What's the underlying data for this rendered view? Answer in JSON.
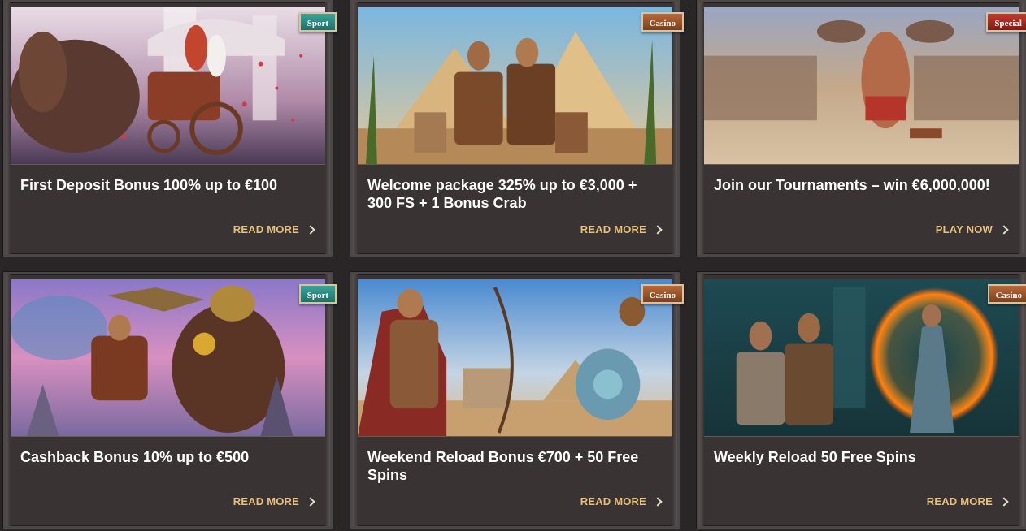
{
  "promotions": [
    {
      "badge": "Sport",
      "badge_type": "sport",
      "title": "First Deposit Bonus 100% up to €100",
      "cta": "READ MORE",
      "image": "chariot-racing-illustration"
    },
    {
      "badge": "Casino",
      "badge_type": "casino",
      "title": "Welcome package 325% up to €3,000 + 300 FS + 1 Bonus Crab",
      "cta": "READ MORE",
      "image": "egyptian-pharaoh-throne-illustration"
    },
    {
      "badge": "Special",
      "badge_type": "special",
      "title": "Join our Tournaments – win €6,000,000!",
      "cta": "PLAY NOW",
      "image": "gladiator-arena-illustration"
    },
    {
      "badge": "Sport",
      "badge_type": "sport",
      "title": "Cashback Bonus 10% up to €500",
      "cta": "READ MORE",
      "image": "warrior-on-horse-with-eagle-illustration"
    },
    {
      "badge": "Casino",
      "badge_type": "casino",
      "title": "Weekend Reload Bonus €700 + 50 Free Spins",
      "cta": "READ MORE",
      "image": "archer-and-egyptian-warrior-illustration"
    },
    {
      "badge": "Casino",
      "badge_type": "casino",
      "title": "Weekly Reload 50 Free Spins",
      "cta": "READ MORE",
      "image": "fire-dancer-illustration"
    }
  ],
  "colors": {
    "card_bg": "#3a3334",
    "cta_text": "#e8c27a",
    "badge_sport": "#2a8a80",
    "badge_casino": "#9a5028",
    "badge_special": "#b02a20"
  }
}
